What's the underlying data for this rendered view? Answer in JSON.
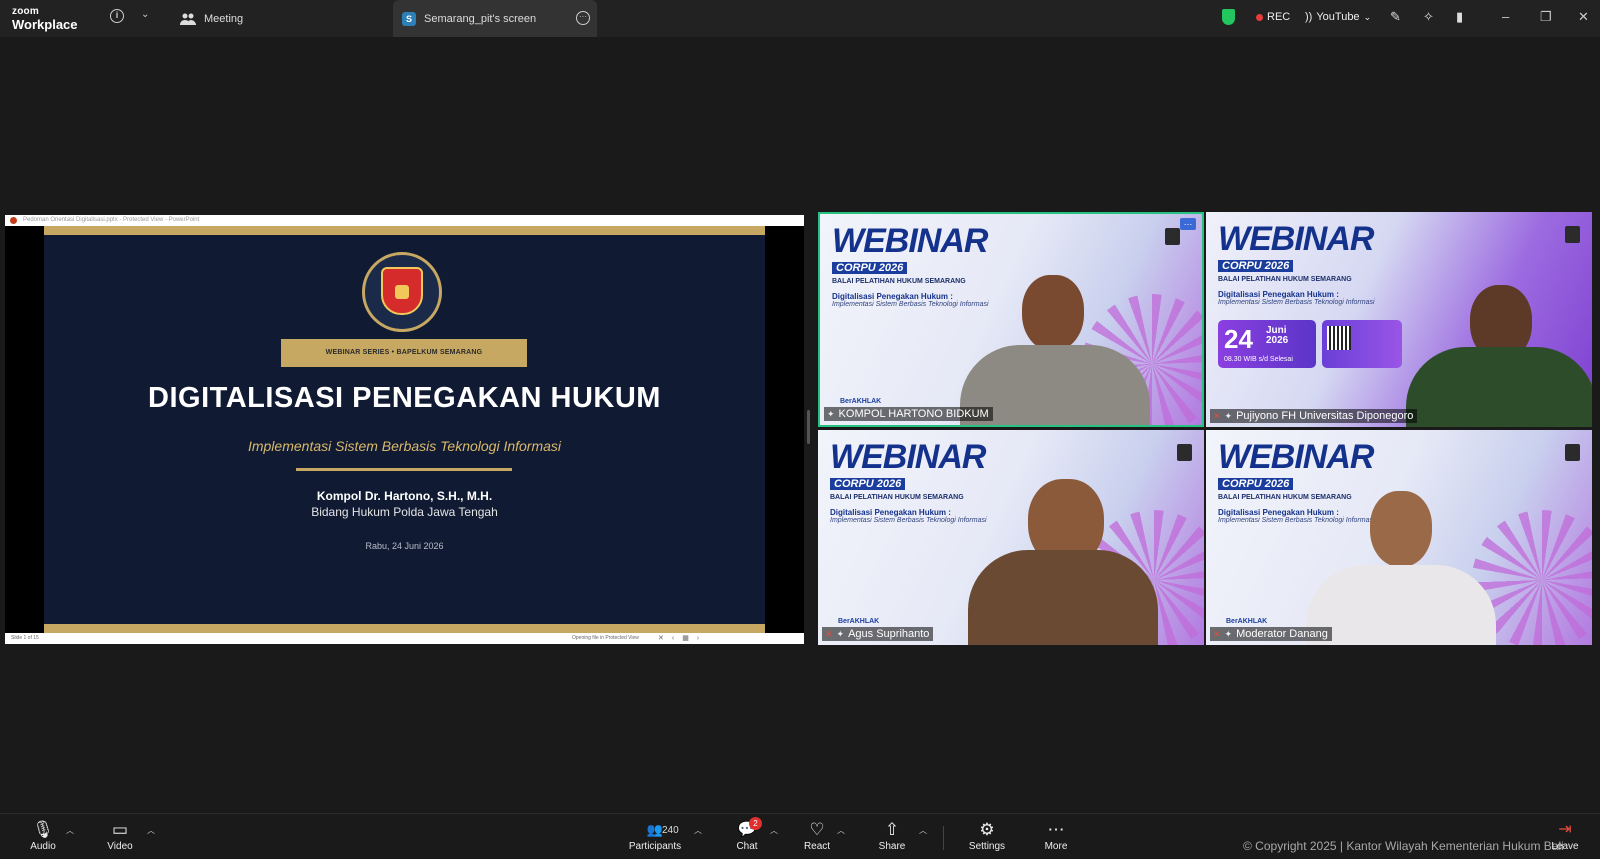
{
  "app": {
    "brand_line1": "zoom",
    "brand_line2": "Workplace"
  },
  "tabs": [
    {
      "label": "Meeting"
    },
    {
      "badge": "S",
      "label": "Semarang_pit's screen"
    }
  ],
  "topbar": {
    "rec_label": "REC",
    "stream_label": "YouTube",
    "shield_color": "#23c55e"
  },
  "powerpoint": {
    "title": "Pedoman Orientasi Digitalisasi.pptx - Protected View - PowerPoint",
    "status_left": "Slide 1 of 15",
    "status_right": "Opening file in Protected View"
  },
  "slide": {
    "series": "WEBINAR SERIES • BAPELKUM SEMARANG",
    "headline": "DIGITALISASI PENEGAKAN HUKUM",
    "subtitle": "Implementasi Sistem Berbasis Teknologi Informasi",
    "presenter": "Kompol Dr. Hartono, S.H., M.H.",
    "organization": "Bidang Hukum Polda Jawa Tengah",
    "date": "Rabu, 24 Juni 2026"
  },
  "tile_banner": {
    "webinar": "WEBINAR",
    "corpu": "CORPU 2026",
    "balai": "BALAI PELATIHAN HUKUM SEMARANG",
    "topic": "Digitalisasi Penegakan Hukum :",
    "impl": "Implementasi Sistem Berbasis Teknologi Informasi",
    "akhlak": "BerAKHLAK"
  },
  "tile2_card": {
    "day": "24",
    "month": "Juni",
    "year": "2026",
    "time": "08.30 WIB s/d Selesai"
  },
  "participants": [
    {
      "name": "KOMPOL HARTONO BIDKUM",
      "active_speaker": true
    },
    {
      "name": "Pujiyono FH Universitas Diponegoro"
    },
    {
      "name": "Agus Suprihanto"
    },
    {
      "name": "Moderator Danang"
    }
  ],
  "toolbar": {
    "audio": "Audio",
    "video": "Video",
    "participants": "Participants",
    "participant_count": "240",
    "chat": "Chat",
    "chat_badge": "2",
    "react": "React",
    "share": "Share",
    "settings": "Settings",
    "more": "More",
    "leave": "Leave"
  },
  "copyright": "© Copyright 2025 | Kantor Wilayah Kementerian Hukum Bali",
  "colors": {
    "accent_gold": "#c6a862",
    "slide_bg": "#101b33",
    "active_border": "#26c281",
    "mute_red": "#e74c3c"
  }
}
